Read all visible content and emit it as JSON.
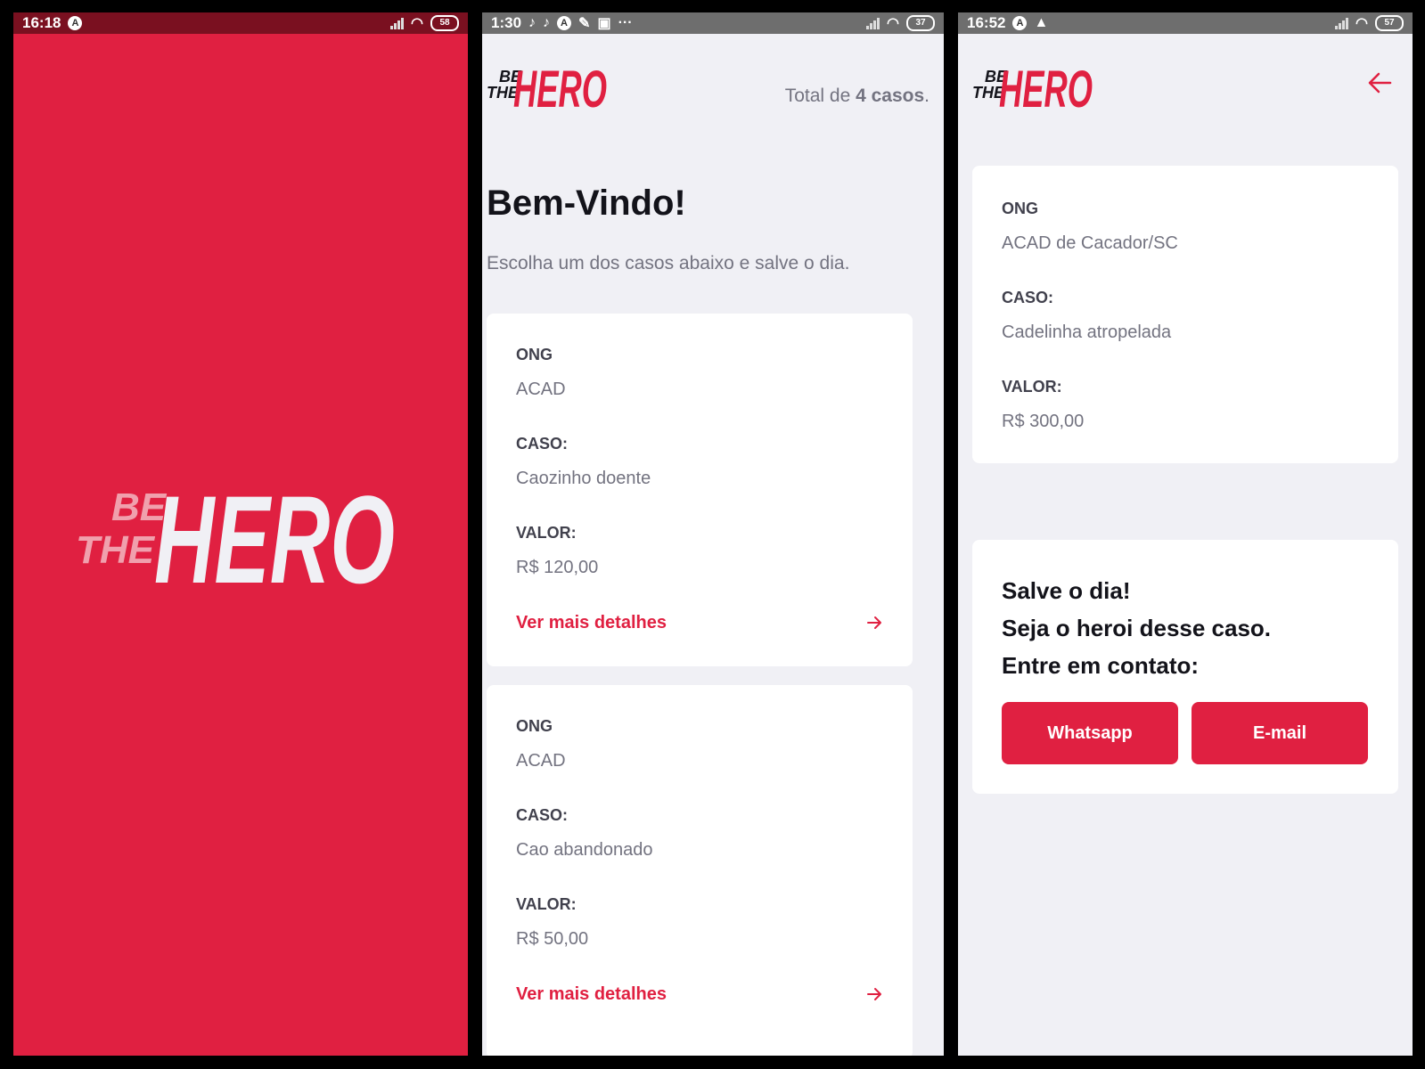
{
  "colors": {
    "brand_red": "#e02041",
    "background": "#f0f0f5",
    "text_dark": "#13131a",
    "text_label": "#41414d",
    "text_muted": "#737380"
  },
  "logo": {
    "line1": "BE",
    "line2": "THE",
    "word": "HERO"
  },
  "screen_splash": {
    "status": {
      "time": "16:18",
      "battery": "58"
    }
  },
  "screen_list": {
    "status": {
      "time": "1:30",
      "battery": "37"
    },
    "total_prefix": "Total de ",
    "total_count": "4 casos",
    "total_suffix": ".",
    "title": "Bem-Vindo!",
    "description": "Escolha um dos casos abaixo e salve o dia.",
    "cards": [
      {
        "ong_label": "ONG",
        "ong": "ACAD",
        "case_label": "CASO:",
        "case": "Caozinho doente",
        "value_label": "VALOR:",
        "value": "R$ 120,00",
        "details": "Ver mais detalhes"
      },
      {
        "ong_label": "ONG",
        "ong": "ACAD",
        "case_label": "CASO:",
        "case": "Cao abandonado",
        "value_label": "VALOR:",
        "value": "R$ 50,00",
        "details": "Ver mais detalhes"
      }
    ]
  },
  "screen_detail": {
    "status": {
      "time": "16:52",
      "battery": "57"
    },
    "ong_label": "ONG",
    "ong": "ACAD de Cacador/SC",
    "case_label": "CASO:",
    "case": "Cadelinha atropelada",
    "value_label": "VALOR:",
    "value": "R$ 300,00",
    "cta_line1": "Salve o dia!",
    "cta_line2": "Seja o heroi desse caso.",
    "cta_line3": "Entre em contato:",
    "whatsapp_label": "Whatsapp",
    "email_label": "E-mail"
  }
}
